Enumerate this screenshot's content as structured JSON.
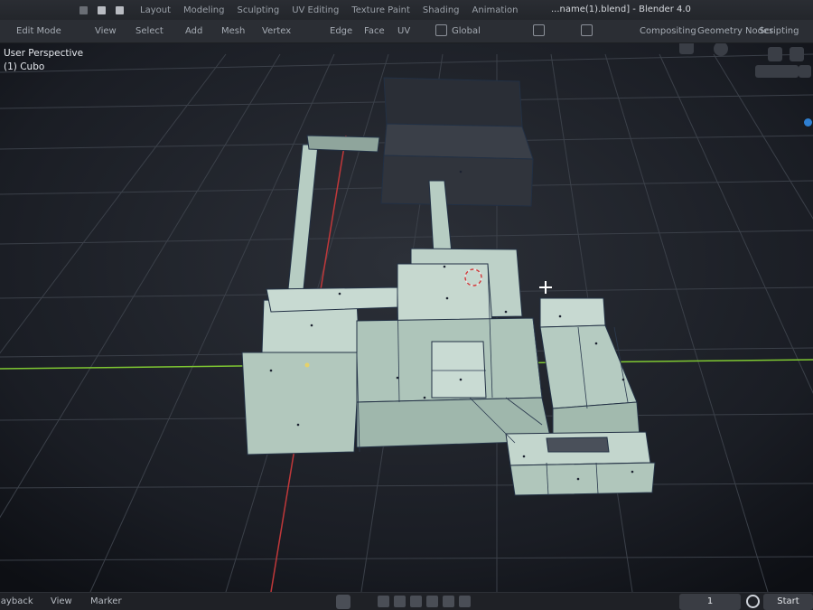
{
  "window": {
    "title": "Blender 4.0",
    "file_fragment": "...name(1).blend]"
  },
  "top_menu": [
    "Layout",
    "Modeling",
    "Sculpting",
    "UV Editing",
    "Texture Paint",
    "Shading",
    "Animation"
  ],
  "header": {
    "mode": "Edit Mode",
    "view": "View",
    "select": "Select",
    "add": "Add",
    "mesh": "Mesh",
    "vertex": "Vertex",
    "edge": "Edge",
    "face": "Face",
    "uv": "UV",
    "transform": "Global",
    "compositing": "Compositing",
    "geometry_nodes": "Geometry Nodes",
    "scripting": "Scripting"
  },
  "viewport": {
    "perspective_label": "User Perspective",
    "object_label": "(1) Cubo",
    "icons": [
      "zoom-icon",
      "pan-icon",
      "camera-view-icon",
      "grid-view-icon",
      "overlay-icon",
      "shading-icon"
    ]
  },
  "timeline": {
    "playback": "Playback",
    "view": "View",
    "marker": "Marker",
    "current_frame": "1",
    "start_label": "Start"
  },
  "colors": {
    "x_axis": "#c0383a",
    "y_axis": "#7fc832",
    "mesh_face": "#a9c3b8",
    "accent": "#2e7fd1"
  }
}
